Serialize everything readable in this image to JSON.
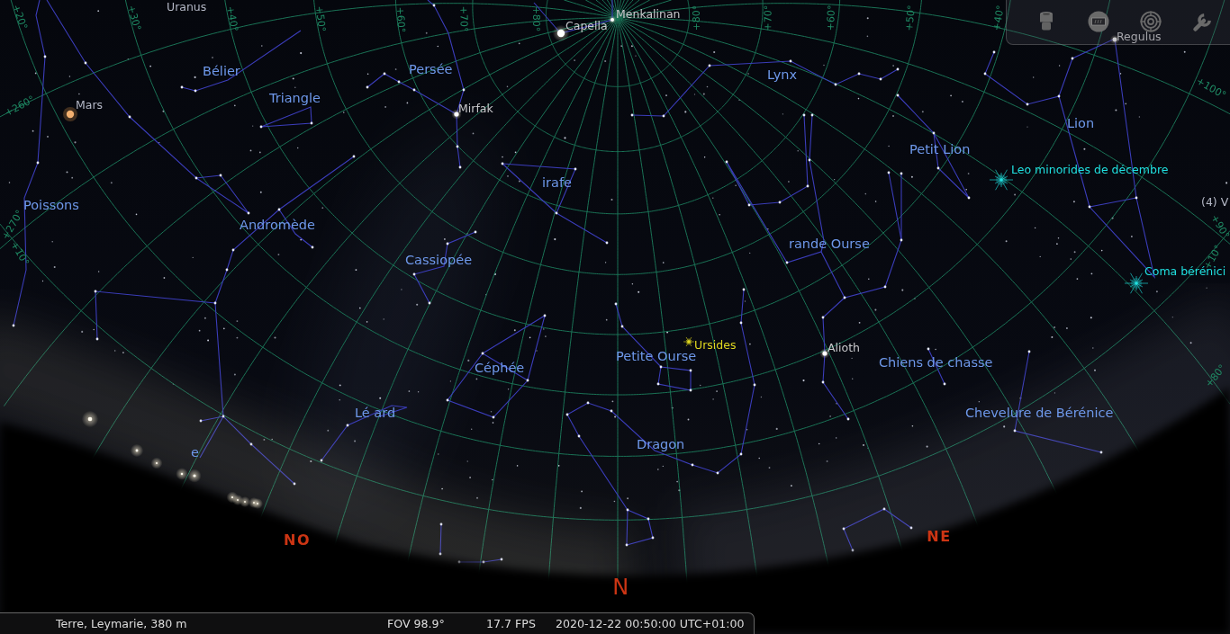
{
  "constellations": [
    "Bélier",
    "Persée",
    "Lynx",
    "Triangle",
    "Lion",
    "Petit Lion",
    "irafe",
    "Poissons",
    "Andromède",
    "rande Ourse",
    "Cassiopée",
    "Petite Ourse",
    "Chiens de chasse",
    "Céphée",
    "Lé ard",
    "Chevelure de Bérénice",
    "Dragon",
    "e"
  ],
  "stars": [
    "Menkalinan",
    "Capella",
    "Regulus",
    "Mirfak",
    "Alioth"
  ],
  "solar_system": [
    "Uranus",
    "Mars",
    "(4) V"
  ],
  "meteor_showers": [
    {
      "name": "Leo minorides de décembre",
      "color": "#20e0e0"
    },
    {
      "name": "Coma bérénici",
      "color": "#20e0e0"
    },
    {
      "name": "Ursides",
      "color": "#e0d820"
    }
  ],
  "grid_labels": [
    "+20°",
    "+30°",
    "+40°",
    "+50°",
    "+60°",
    "+70°",
    "+80°",
    "+80°",
    "+70°",
    "+60°",
    "+50°",
    "+40°",
    "+260°",
    "+270°",
    "+10°",
    "+100°",
    "+90°",
    "+10°",
    "+80°"
  ],
  "cardinal_points": [
    "NO",
    "N",
    "NE"
  ],
  "status_bar": {
    "location": "Terre, Leymarie, 380 m",
    "fov": "FOV 98.9°",
    "fps": "17.7 FPS",
    "datetime": "2020-12-22 00:50:00 UTC+01:00"
  }
}
